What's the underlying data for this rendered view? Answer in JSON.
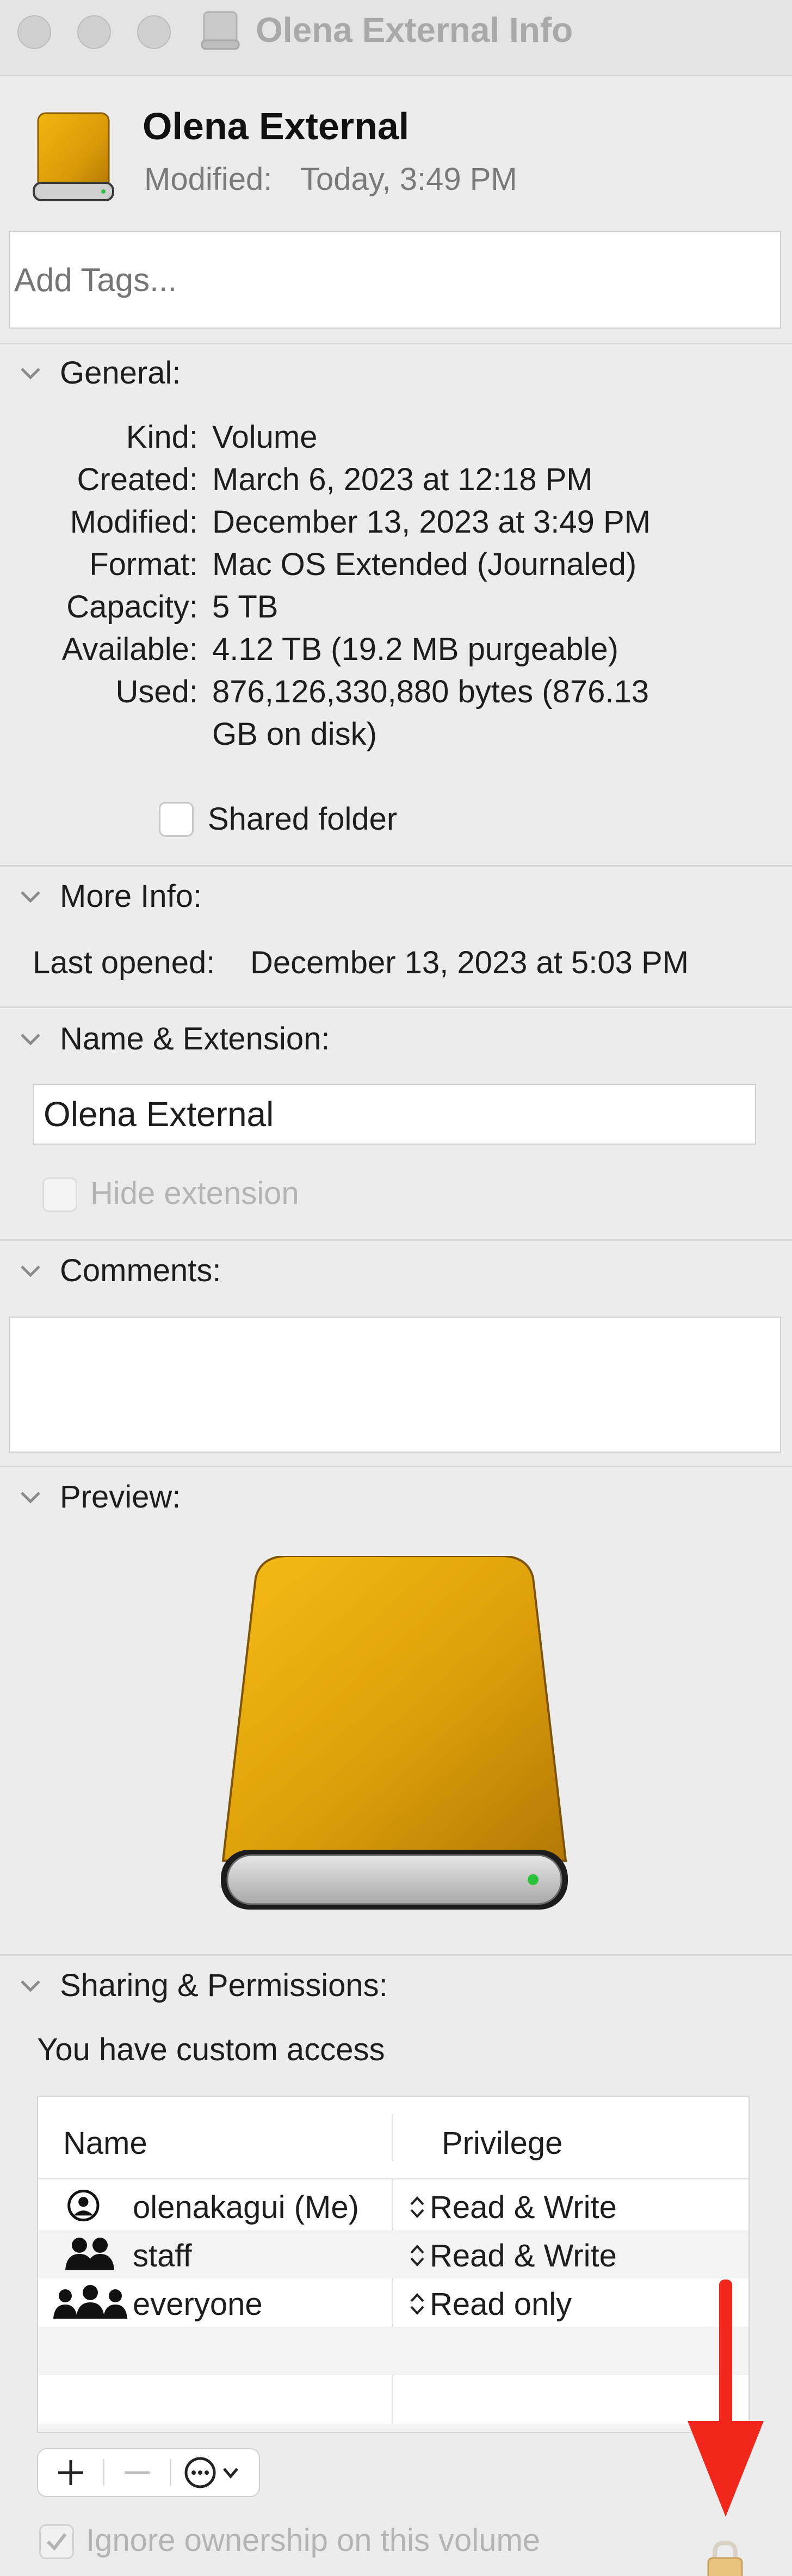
{
  "window": {
    "title": "Olena External Info"
  },
  "header": {
    "name": "Olena External",
    "modified_label": "Modified:",
    "modified_value": "Today, 3:49 PM"
  },
  "tags": {
    "placeholder": "Add Tags..."
  },
  "general": {
    "title": "General:",
    "rows": [
      {
        "label": "Kind:",
        "value": "Volume"
      },
      {
        "label": "Created:",
        "value": "March 6, 2023 at 12:18 PM"
      },
      {
        "label": "Modified:",
        "value": "December 13, 2023 at 3:49 PM"
      },
      {
        "label": "Format:",
        "value": "Mac OS Extended (Journaled)"
      },
      {
        "label": "Capacity:",
        "value": "5 TB"
      },
      {
        "label": "Available:",
        "value": "4.12 TB (19.2 MB purgeable)"
      },
      {
        "label": "Used:",
        "value": "876,126,330,880 bytes (876.13",
        "value2": "GB on disk)"
      }
    ],
    "shared_folder_label": "Shared folder"
  },
  "more_info": {
    "title": "More Info:",
    "last_opened_label": "Last opened:",
    "last_opened_value": "December 13, 2023 at 5:03 PM"
  },
  "name_extension": {
    "title": "Name & Extension:",
    "name_value": "Olena External",
    "hide_extension_label": "Hide extension"
  },
  "comments": {
    "title": "Comments:"
  },
  "preview": {
    "title": "Preview:"
  },
  "sharing": {
    "title": "Sharing & Permissions:",
    "access_text": "You have custom access",
    "columns": {
      "name": "Name",
      "privilege": "Privilege"
    },
    "rows": [
      {
        "name": "olenakagui (Me)",
        "privilege": "Read & Write",
        "icon": "single-user-icon"
      },
      {
        "name": "staff",
        "privilege": "Read & Write",
        "icon": "group-icon"
      },
      {
        "name": "everyone",
        "privilege": "Read only",
        "icon": "everyone-icon"
      }
    ],
    "ignore_ownership_label": "Ignore ownership on this volume"
  },
  "colors": {
    "drive_gold": "#e0a20a",
    "accent_arrow": "#f0271a",
    "lock": "#e8c27f"
  }
}
